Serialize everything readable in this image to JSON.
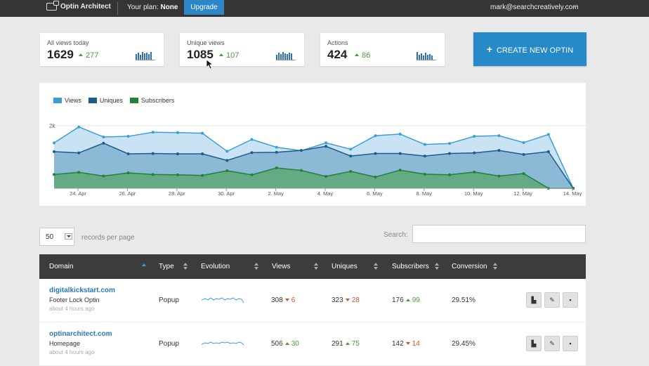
{
  "topbar": {
    "app_name": "Optin Architect",
    "plan_prefix": "Your plan: ",
    "plan_name": "None",
    "upgrade_label": "Upgrade",
    "user_email": "mark@searchcreatively.com"
  },
  "stats": [
    {
      "label": "All views today",
      "value": "1629",
      "delta": "277"
    },
    {
      "label": "Unique views",
      "value": "1085",
      "delta": "107"
    },
    {
      "label": "Actions",
      "value": "424",
      "delta": "86"
    }
  ],
  "create_button": {
    "label": "CREATE NEW OPTIN"
  },
  "colors": {
    "views": "#3a9fd7",
    "uniques": "#1d5b8c",
    "subscribers": "#22813a",
    "accent": "#2689c8"
  },
  "chart_data": {
    "type": "area",
    "legend": [
      "Views",
      "Uniques",
      "Subscribers"
    ],
    "y_tick": "2k",
    "x_tick_labels": [
      "24. Apr",
      "26. Apr",
      "28. Apr",
      "30. Apr",
      "2. May",
      "4. May",
      "6. May",
      "8. May",
      "10. May",
      "12. May",
      "14. May"
    ],
    "series": [
      {
        "name": "Views",
        "values": [
          1450,
          1960,
          1640,
          1660,
          1790,
          1780,
          1760,
          1180,
          1560,
          1310,
          1200,
          1450,
          1250,
          1680,
          1730,
          1400,
          1430,
          1660,
          1680,
          1460,
          1720,
          0
        ]
      },
      {
        "name": "Uniques",
        "values": [
          1170,
          1130,
          1440,
          1100,
          1110,
          1100,
          1100,
          890,
          1140,
          1150,
          1210,
          1340,
          1030,
          1110,
          1110,
          1030,
          1110,
          1130,
          1210,
          1080,
          1170,
          0
        ]
      },
      {
        "name": "Subscribers",
        "values": [
          440,
          510,
          390,
          490,
          440,
          430,
          410,
          560,
          430,
          650,
          570,
          380,
          540,
          360,
          580,
          450,
          430,
          520,
          390,
          470,
          0,
          0
        ]
      }
    ],
    "ylim": [
      0,
      2200
    ]
  },
  "table_controls": {
    "page_size": "50",
    "records_label": "records per page",
    "search_label": "Search:"
  },
  "table": {
    "headers": [
      "Domain",
      "Type",
      "Evolution",
      "Views",
      "Uniques",
      "Subscribers",
      "Conversion"
    ],
    "rows": [
      {
        "domain": "digitalkickstart.com",
        "name": "Footer Lock Optin",
        "ago": "about 4 hours ago",
        "type": "Popup",
        "views": "308",
        "views_delta": "6",
        "views_dir": "down",
        "uniques": "323",
        "uniques_delta": "28",
        "uniques_dir": "down",
        "subs": "176",
        "subs_delta": "99",
        "subs_dir": "up",
        "conversion": "29.51%"
      },
      {
        "domain": "optinarchitect.com",
        "name": "Homepage",
        "ago": "about 4 hours ago",
        "type": "Popup",
        "views": "506",
        "views_delta": "30",
        "views_dir": "up",
        "uniques": "291",
        "uniques_delta": "75",
        "uniques_dir": "up",
        "subs": "142",
        "subs_delta": "14",
        "subs_dir": "down",
        "conversion": "29.45%"
      }
    ]
  }
}
